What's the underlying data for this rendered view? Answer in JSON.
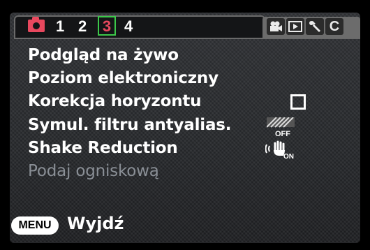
{
  "tabs": {
    "numbers": [
      "1",
      "2",
      "3",
      "4"
    ],
    "selected_index": 2,
    "icons": [
      "camera-icon",
      "video-camera-icon",
      "playback-icon",
      "wrench-icon",
      "custom-c-icon"
    ],
    "custom_label": "C"
  },
  "menu": {
    "items": [
      {
        "label": "Podgląd na żywo",
        "enabled": true
      },
      {
        "label": "Poziom elektroniczny",
        "enabled": true
      },
      {
        "label": "Korekcja horyzontu",
        "enabled": true,
        "value": "checkbox-unchecked"
      },
      {
        "label": "Symul. filtru antyalias.",
        "enabled": true,
        "value_icon": "aa-filter-off-icon",
        "value_text": "OFF"
      },
      {
        "label": "Shake Reduction",
        "enabled": true,
        "value_icon": "shake-reduction-on-icon",
        "value_text": "ON"
      },
      {
        "label": "Podaj ogniskową",
        "enabled": false
      }
    ]
  },
  "footer": {
    "menu_button": "MENU",
    "exit_label": "Wyjdź"
  },
  "colors": {
    "accent_red": "#e8485e",
    "selected_border": "#3cc84a",
    "background": "#2a2a2a"
  }
}
